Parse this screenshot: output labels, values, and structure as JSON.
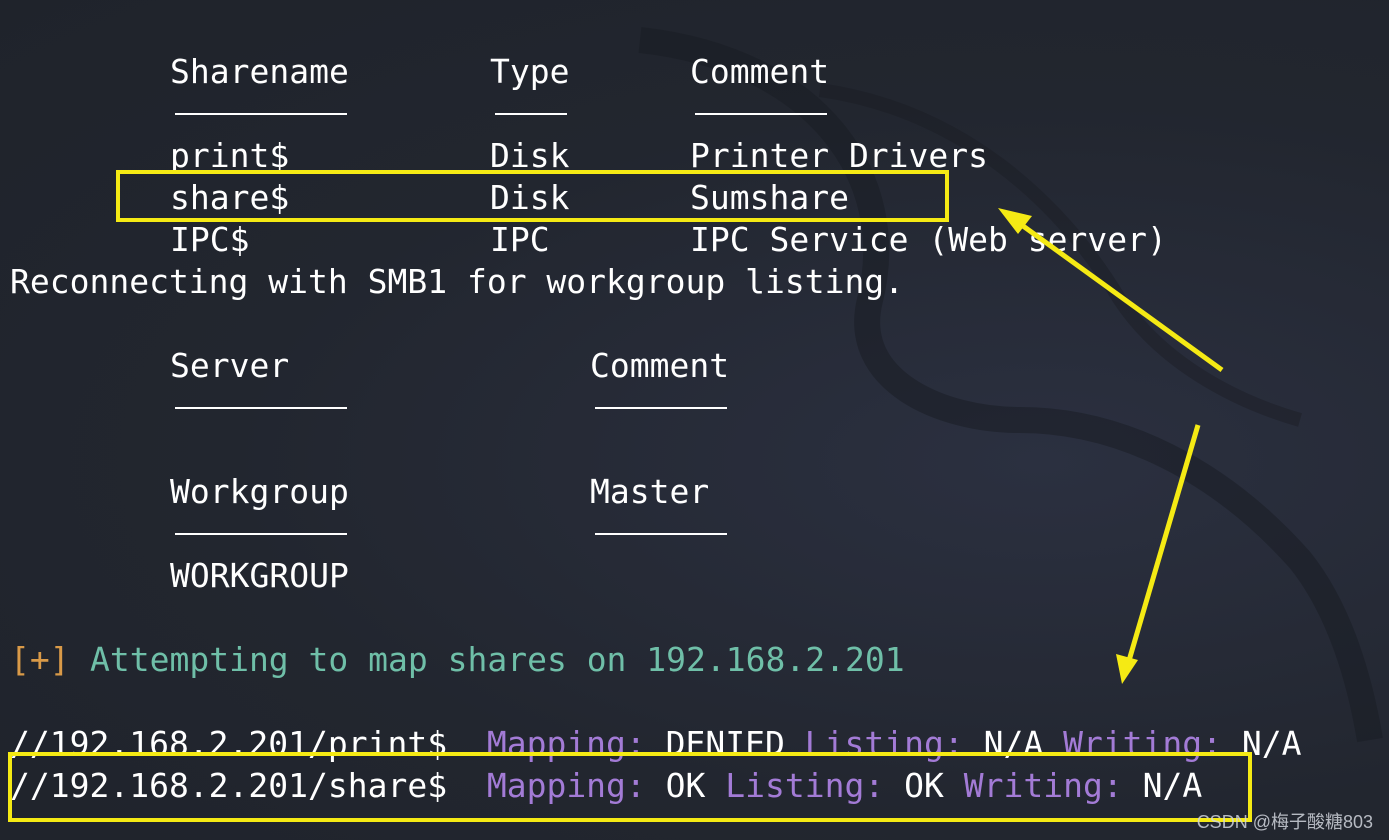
{
  "share_table": {
    "headers": [
      "Sharename",
      "Type",
      "Comment"
    ],
    "rows": [
      [
        "print$",
        "Disk",
        "Printer Drivers"
      ],
      [
        "share$",
        "Disk",
        "Sumshare"
      ],
      [
        "IPC$",
        "IPC",
        "IPC Service (Web server)"
      ]
    ]
  },
  "reconnect_line": "Reconnecting with SMB1 for workgroup listing.",
  "server_table": {
    "headers": [
      "Server",
      "Comment"
    ]
  },
  "workgroup_table": {
    "headers": [
      "Workgroup",
      "Master"
    ],
    "rows": [
      [
        "WORKGROUP",
        ""
      ]
    ]
  },
  "attempt_line": {
    "prefix": "[+]",
    "text": "Attempting to map shares on 192.168.2.201"
  },
  "mapping_results": [
    {
      "path": "//192.168.2.201/print$",
      "mapping_label": "Mapping:",
      "mapping_value": "DENIED",
      "listing_label": "Listing:",
      "listing_value": "N/A",
      "writing_label": "Writing:",
      "writing_value": "N/A"
    },
    {
      "path": "//192.168.2.201/share$",
      "mapping_label": "Mapping:",
      "mapping_value": "OK",
      "listing_label": "Listing:",
      "listing_value": "OK",
      "writing_label": "Writing:",
      "writing_value": "N/A"
    }
  ],
  "watermark": "CSDN @梅子酸糖803",
  "colors": {
    "background": "#22262f",
    "text": "#ffffff",
    "green": "#6fbfa8",
    "orange": "#d99a48",
    "purple": "#a37bd6",
    "annotation": "#f5ea14"
  }
}
